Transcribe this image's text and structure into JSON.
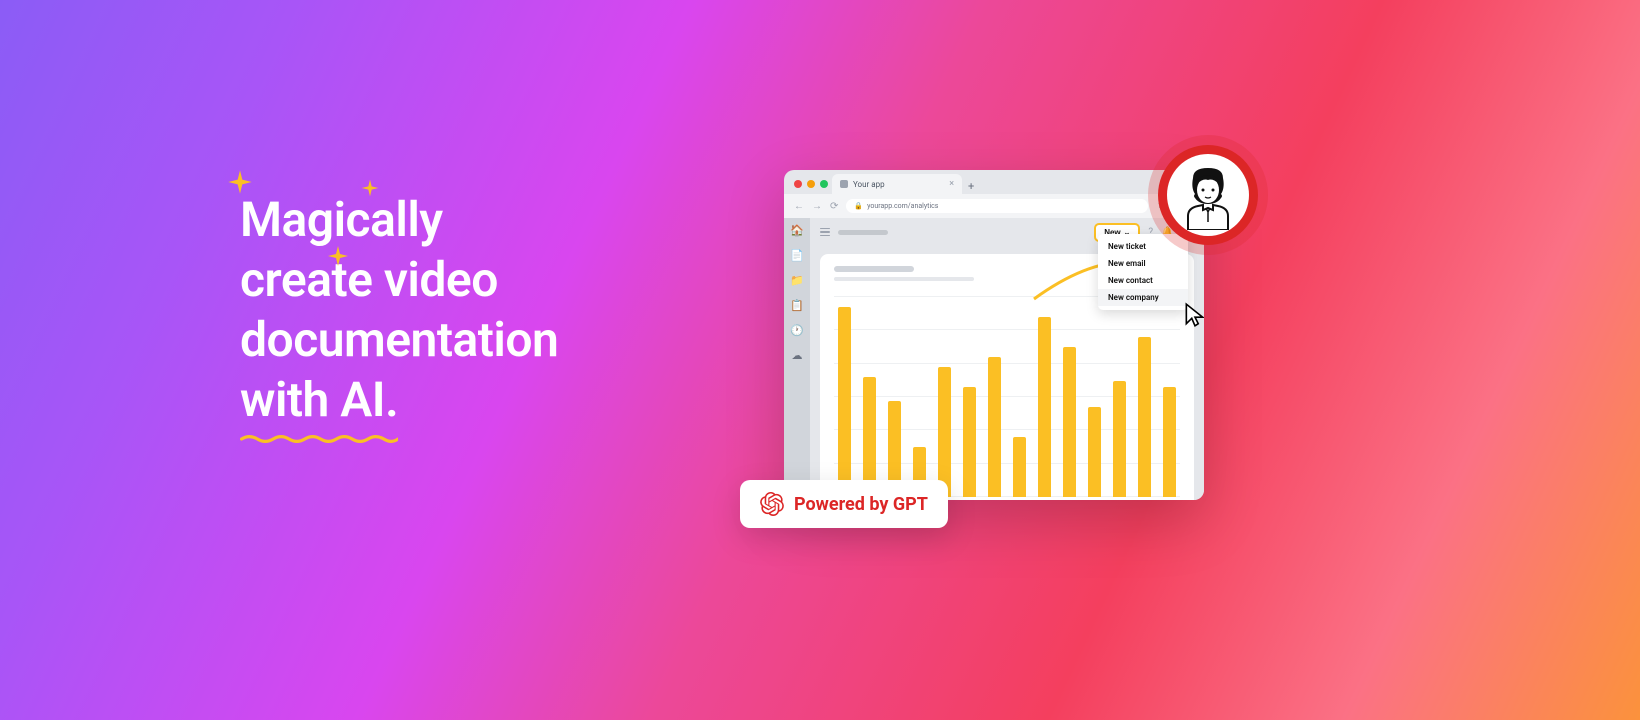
{
  "headline": {
    "l1": "Magically",
    "l2": "create video",
    "l3": "documentation",
    "l4": "with AI."
  },
  "browser": {
    "tab_title": "Your app",
    "url": "yourapp.com/analytics"
  },
  "new_button": {
    "label": "New"
  },
  "dropdown": [
    "New ticket",
    "New email",
    "New contact",
    "New company"
  ],
  "badge": {
    "text": "Powered by GPT"
  },
  "chart_data": {
    "type": "bar",
    "values": [
      95,
      60,
      48,
      25,
      65,
      55,
      70,
      30,
      90,
      75,
      45,
      58,
      80,
      55
    ],
    "ylim": [
      0,
      100
    ]
  }
}
